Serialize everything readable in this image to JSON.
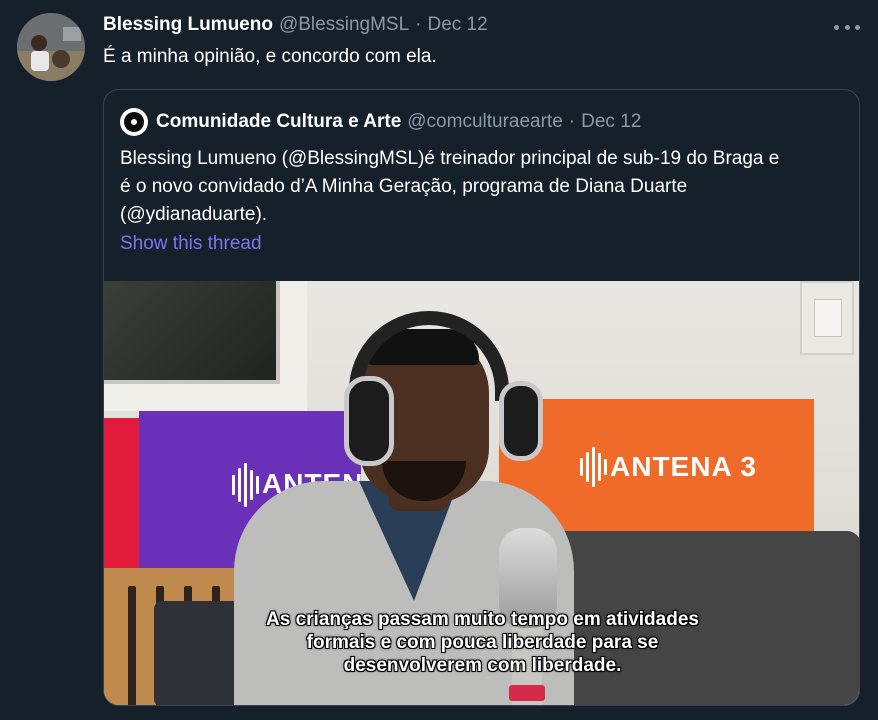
{
  "tweet": {
    "author_name": "Blessing Lumueno",
    "author_handle": "@BlessingMSL",
    "separator": "·",
    "date": "Dec 12",
    "text": "É a minha opinião, e concordo com ela."
  },
  "quoted_tweet": {
    "author_name": "Comunidade Cultura e Arte",
    "author_handle": "@comculturaearte",
    "separator": "·",
    "date": "Dec 12",
    "text_lines": [
      "Blessing Lumueno (@BlessingMSL)é treinador principal de sub-19 do Braga e",
      "é o novo convidado d’A Minha Geração, programa de Diana Duarte",
      "(@ydianaduarte)."
    ],
    "thread_link": "Show this thread",
    "media": {
      "brand_left": "ANTEN",
      "brand_right": "ANTENA 3",
      "subtitle_lines": [
        "As crianças passam muito tempo em atividades",
        "formais e com pouca liberdade para se",
        "desenvolverem com liberdade."
      ]
    }
  },
  "icons": [
    "more-icon",
    "quoted-avatar-icon"
  ],
  "colors": {
    "background": "#15202b",
    "secondary_text": "#8b98a5",
    "link": "#7f73f0",
    "border": "#38444d"
  }
}
